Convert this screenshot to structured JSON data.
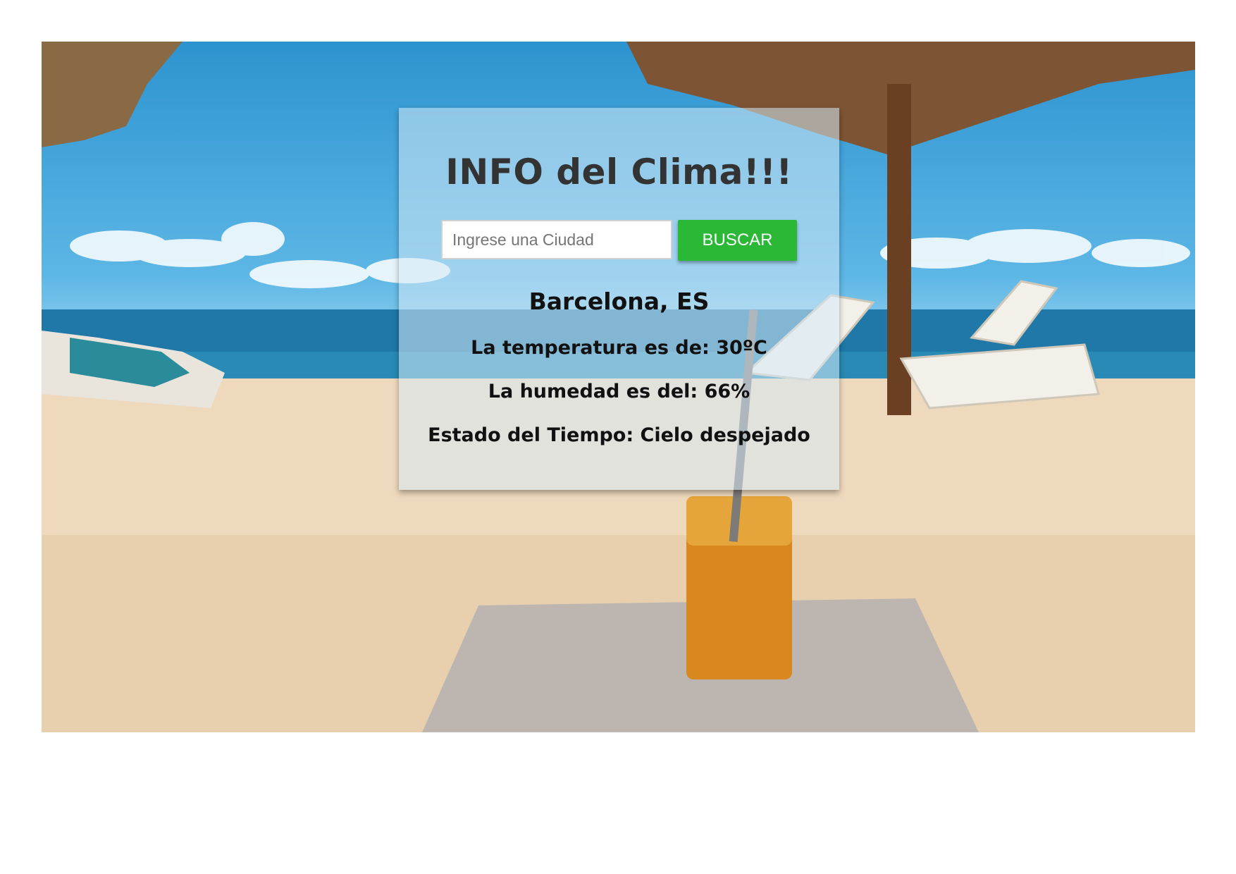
{
  "app": {
    "title": "INFO del Clima!!!"
  },
  "search": {
    "placeholder": "Ingrese una Ciudad",
    "value": "",
    "button_label": "BUSCAR"
  },
  "result": {
    "city": "Barcelona, ES",
    "temperature": "La temperatura es de: 30ºC",
    "humidity": "La humedad es del: 66%",
    "state": "Estado del Tiempo: Cielo despejado"
  },
  "colors": {
    "button": "#2bb836",
    "title": "#333333",
    "card": "rgba(214,234,246,0.55)"
  }
}
